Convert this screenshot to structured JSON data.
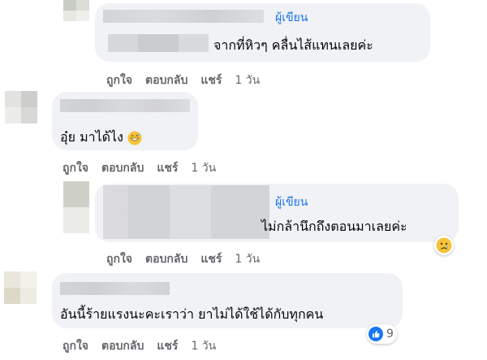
{
  "comments": [
    {
      "author_badge": "ผู้เขียน",
      "text": "จากที่หิวๆ คลื่นไส้แทนเลยค่ะ",
      "actions": {
        "like": "ถูกใจ",
        "reply": "ตอบกลับ",
        "share": "แชร์",
        "time": "1 วัน"
      }
    },
    {
      "text": "อุ๋ย มาได้ไง",
      "emoji": "grinning-sweat-face",
      "actions": {
        "like": "ถูกใจ",
        "reply": "ตอบกลับ",
        "share": "แชร์",
        "time": "1 วัน"
      }
    },
    {
      "author_badge": "ผู้เขียน",
      "text": "ไม่กล้านึกถึงตอนมาเลยค่ะ",
      "emoji": "sad-face",
      "actions": {
        "like": "ถูกใจ",
        "reply": "ตอบกลับ",
        "share": "แชร์",
        "time": "1 วัน"
      }
    },
    {
      "text": "อันนี้ร้ายแรงนะคะเราว่า ยาไม่ได้ใช้ได้กับทุกคน",
      "reaction": {
        "icon": "like-icon",
        "count": "9",
        "color": "#1877f2"
      },
      "actions": {
        "like": "ถูกใจ",
        "reply": "ตอบกลับ",
        "share": "แชร์",
        "time": "1 วัน"
      }
    }
  ],
  "colors": {
    "bubble": "#f0f2f5",
    "author": "#1b74e4",
    "meta": "#65676b",
    "text": "#050505"
  }
}
